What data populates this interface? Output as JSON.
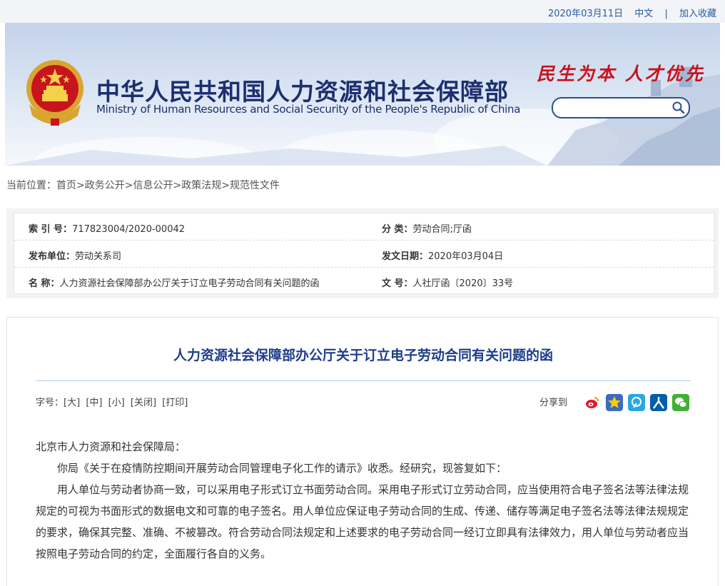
{
  "topbar": {
    "date": "2020年03月11日",
    "lang": "中文",
    "sep": "|",
    "bookmark": "加入收藏"
  },
  "banner": {
    "title_cn": "中华人民共和国人力资源和社会保障部",
    "title_en": "Ministry of Human Resources and Social Security of the People's Republic of China",
    "slogan": "民生为本 人才优先",
    "search_placeholder": ""
  },
  "breadcrumb": {
    "prefix": "当前位置：",
    "items": [
      "首页",
      "政务公开",
      "信息公开",
      "政策法规",
      "规范性文件"
    ],
    "sep": ">"
  },
  "meta": {
    "index_label": "索 引 号：",
    "index_value": "717823004/2020-00042",
    "category_label": "分 类：",
    "category_value": "劳动合同;厅函",
    "publisher_label": "发布单位：",
    "publisher_value": "劳动关系司",
    "date_label": "发文日期：",
    "date_value": "2020年03月04日",
    "name_label": "名 称：",
    "name_value": "人力资源社会保障部办公厅关于订立电子劳动合同有关问题的函",
    "docno_label": "文 号：",
    "docno_value": "人社厅函〔2020〕33号"
  },
  "article": {
    "title": "人力资源社会保障部办公厅关于订立电子劳动合同有关问题的函",
    "font_label": "字号：",
    "tools": [
      "[大]",
      "[中]",
      "[小]",
      "[关闭]",
      "[打印]"
    ],
    "share_label": "分享到",
    "share_icons": [
      "weibo-icon",
      "qzone-icon",
      "tencent-weibo-icon",
      "renren-icon",
      "wechat-icon"
    ],
    "salutation": "北京市人力资源和社会保障局：",
    "para1": "你局《关于在疫情防控期间开展劳动合同管理电子化工作的请示》收悉。经研究，现答复如下：",
    "para2": "用人单位与劳动者协商一致，可以采用电子形式订立书面劳动合同。采用电子形式订立劳动合同，应当使用符合电子签名法等法律法规规定的可视为书面形式的数据电文和可靠的电子签名。用人单位应保证电子劳动合同的生成、传递、储存等满足电子签名法等法律法规规定的要求，确保其完整、准确、不被篡改。符合劳动合同法规定和上述要求的电子劳动合同一经订立即具有法律效力，用人单位与劳动者应当按照电子劳动合同的约定，全面履行各自的义务。"
  },
  "colors": {
    "accent": "#1f3d8a",
    "link": "#2b5aa0",
    "slogan": "#c9121b"
  }
}
